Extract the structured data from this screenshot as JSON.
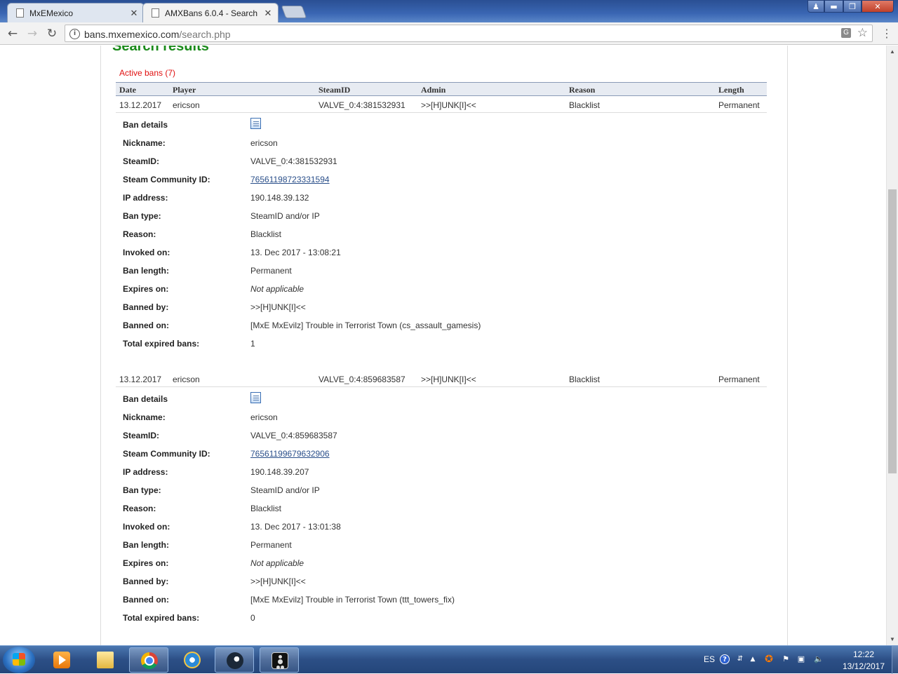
{
  "browser": {
    "tabs": [
      {
        "title": "MxEMexico",
        "active": false
      },
      {
        "title": "AMXBans 6.0.4 - Search",
        "active": true
      }
    ],
    "url_host": "bans.mxemexico.com",
    "url_path": "/search.php",
    "window_buttons": {
      "minimize": "▬",
      "maximize": "❐",
      "close": "✕"
    }
  },
  "page": {
    "title": "Search results",
    "active_bans_label": "Active bans (7)",
    "columns": [
      "Date",
      "Player",
      "SteamID",
      "Admin",
      "Reason",
      "Length"
    ],
    "detail_labels": {
      "ban_details": "Ban details",
      "nickname": "Nickname:",
      "steamid": "SteamID:",
      "community_id": "Steam Community ID:",
      "ip": "IP address:",
      "ban_type": "Ban type:",
      "reason": "Reason:",
      "invoked_on": "Invoked on:",
      "ban_length": "Ban length:",
      "expires_on": "Expires on:",
      "banned_by": "Banned by:",
      "banned_on": "Banned on:",
      "total_expired": "Total expired bans:"
    },
    "bans": [
      {
        "date": "13.12.2017",
        "player": "ericson",
        "steamid": "VALVE_0:4:381532931",
        "admin": ">>[H]UNK[I]<<",
        "reason": "Blacklist",
        "length": "Permanent",
        "details": {
          "nickname": "ericson",
          "steamid": "VALVE_0:4:381532931",
          "community_id": "76561198723331594",
          "ip": "190.148.39.132",
          "ban_type": "SteamID and/or IP",
          "reason": "Blacklist",
          "invoked_on": "13. Dec 2017 - 13:08:21",
          "ban_length": "Permanent",
          "expires_on": "Not applicable",
          "banned_by": ">>[H]UNK[I]<<",
          "banned_on": "[MxE MxEvilz] Trouble in Terrorist Town (cs_assault_gamesis)",
          "total_expired": "1"
        }
      },
      {
        "date": "13.12.2017",
        "player": "ericson",
        "steamid": "VALVE_0:4:859683587",
        "admin": ">>[H]UNK[I]<<",
        "reason": "Blacklist",
        "length": "Permanent",
        "details": {
          "nickname": "ericson",
          "steamid": "VALVE_0:4:859683587",
          "community_id": "76561199679632906",
          "ip": "190.148.39.207",
          "ban_type": "SteamID and/or IP",
          "reason": "Blacklist",
          "invoked_on": "13. Dec 2017 - 13:01:38",
          "ban_length": "Permanent",
          "expires_on": "Not applicable",
          "banned_by": ">>[H]UNK[I]<<",
          "banned_on": "[MxE MxEvilz] Trouble in Terrorist Town (ttt_towers_fix)",
          "total_expired": "0"
        }
      }
    ]
  },
  "taskbar": {
    "language": "ES",
    "time": "12:22",
    "date": "13/12/2017",
    "tray_icons": [
      "help-icon",
      "network-status-icon",
      "show-hidden-icons-arrow",
      "avast-icon",
      "action-center-flag-icon",
      "network-icon",
      "volume-icon"
    ]
  },
  "colors": {
    "title_green": "#1a8a1a",
    "active_bans_red": "#e01010",
    "link_blue": "#2a4f8a",
    "header_bg": "#e7ebf2"
  }
}
